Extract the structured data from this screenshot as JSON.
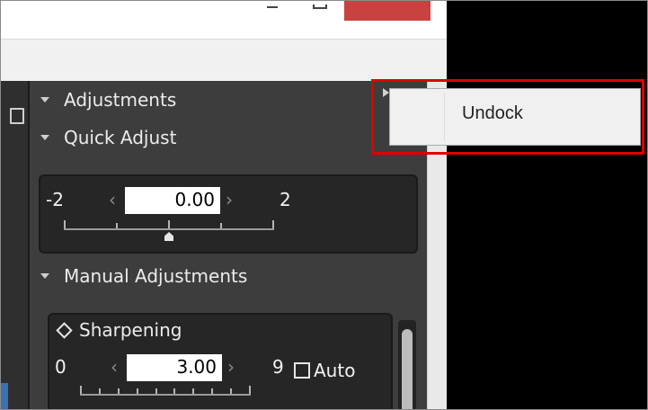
{
  "palette": {
    "adjustments_label": "Adjustments",
    "quick_adjust": {
      "label": "Quick Adjust",
      "min": "-2",
      "max": "2",
      "value": "0.00",
      "slider_fraction": 0.5
    },
    "manual_adjustments_label": "Manual Adjustments",
    "sharpening": {
      "label": "Sharpening",
      "min": "0",
      "max": "9",
      "value": "3.00",
      "auto_label": "Auto",
      "auto_checked": false
    }
  },
  "context_menu": {
    "items": [
      "Undock"
    ]
  },
  "icons": {
    "collapse": "collapse-triangle-icon",
    "dock": "dock-arrow-icon",
    "decrement": "arrow-left-icon",
    "increment": "arrow-right-icon",
    "sharpening": "diamond-icon"
  },
  "colors": {
    "highlight": "#e00000",
    "close_button": "#c8423f",
    "panel_bg": "#3d3d3d"
  }
}
